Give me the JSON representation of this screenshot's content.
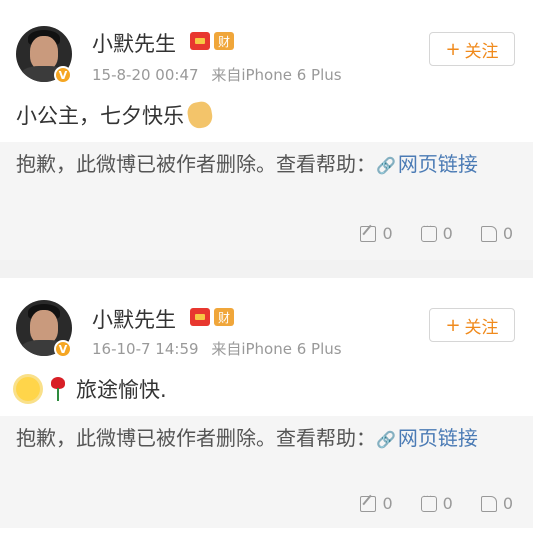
{
  "posts": [
    {
      "username": "小默先生",
      "badge_gold": "财",
      "timestamp": "15-8-20 00:47",
      "source": "来自iPhone 6 Plus",
      "follow_label": "关注",
      "follow_plus": "+",
      "content_text": "小公主，七夕快乐",
      "emoji_trailing": "hand-rock-icon",
      "repost_notice": "抱歉，此微博已被作者删除。查看帮助：",
      "repost_link_icon": "link-icon",
      "repost_link": "网页链接",
      "repost_count": "0",
      "comment_count": "0",
      "like_count": "0"
    },
    {
      "username": "小默先生",
      "badge_gold": "财",
      "timestamp": "16-10-7 14:59",
      "source": "来自iPhone 6 Plus",
      "follow_label": "关注",
      "follow_plus": "+",
      "emoji_leading": [
        "sun-flower-icon",
        "rose-icon"
      ],
      "content_text": "旅途愉快.",
      "repost_notice": "抱歉，此微博已被作者删除。查看帮助：",
      "repost_link_icon": "link-icon",
      "repost_link": "网页链接",
      "repost_count": "0",
      "comment_count": "0",
      "like_count": "0"
    }
  ],
  "colors": {
    "accent_orange": "#f08a1c",
    "link_blue": "#4b7bb5",
    "verify_badge": "#f5a623",
    "red_badge": "#e8372f"
  }
}
